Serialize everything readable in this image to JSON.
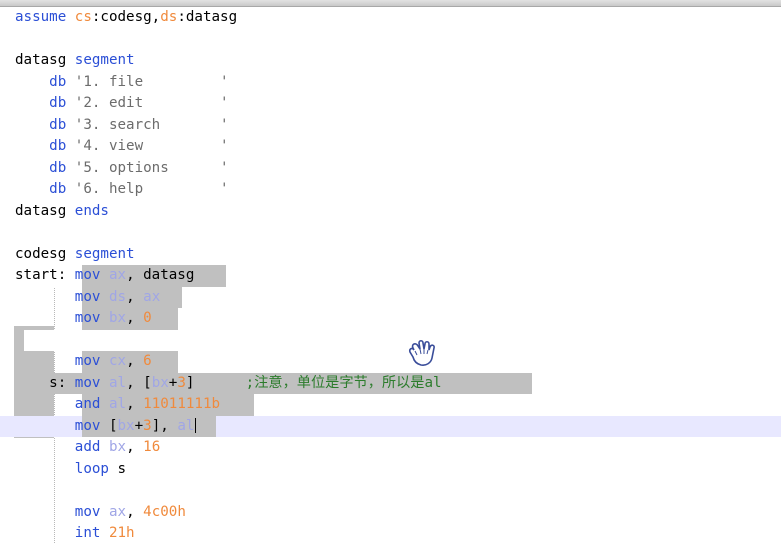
{
  "lines": [
    {
      "tokens": [
        [
          "kw",
          "assume "
        ],
        [
          "num",
          "cs"
        ],
        [
          "blk",
          ":codesg,"
        ],
        [
          "num",
          "ds"
        ],
        [
          "blk",
          ":datasg"
        ]
      ]
    },
    {
      "tokens": []
    },
    {
      "tokens": [
        [
          "blk",
          "datasg "
        ],
        [
          "kw",
          "segment"
        ]
      ]
    },
    {
      "tokens": [
        [
          "blk",
          "    "
        ],
        [
          "kw",
          "db "
        ],
        [
          "str",
          "'1. file         '"
        ]
      ]
    },
    {
      "tokens": [
        [
          "blk",
          "    "
        ],
        [
          "kw",
          "db "
        ],
        [
          "str",
          "'2. edit         '"
        ]
      ]
    },
    {
      "tokens": [
        [
          "blk",
          "    "
        ],
        [
          "kw",
          "db "
        ],
        [
          "str",
          "'3. search       '"
        ]
      ]
    },
    {
      "tokens": [
        [
          "blk",
          "    "
        ],
        [
          "kw",
          "db "
        ],
        [
          "str",
          "'4. view         '"
        ]
      ]
    },
    {
      "tokens": [
        [
          "blk",
          "    "
        ],
        [
          "kw",
          "db "
        ],
        [
          "str",
          "'5. options      '"
        ]
      ]
    },
    {
      "tokens": [
        [
          "blk",
          "    "
        ],
        [
          "kw",
          "db "
        ],
        [
          "str",
          "'6. help         '"
        ]
      ]
    },
    {
      "tokens": [
        [
          "blk",
          "datasg "
        ],
        [
          "kw",
          "ends"
        ]
      ]
    },
    {
      "tokens": []
    },
    {
      "tokens": [
        [
          "blk",
          "codesg "
        ],
        [
          "kw",
          "segment"
        ]
      ]
    },
    {
      "tokens": [
        [
          "blk",
          "start: "
        ],
        [
          "ins",
          "mov "
        ],
        [
          "reg",
          "ax"
        ],
        [
          "blk",
          ", datasg"
        ]
      ]
    },
    {
      "tokens": [
        [
          "blk",
          "       "
        ],
        [
          "ins",
          "mov "
        ],
        [
          "reg",
          "ds"
        ],
        [
          "blk",
          ", "
        ],
        [
          "reg",
          "ax"
        ]
      ]
    },
    {
      "tokens": [
        [
          "blk",
          "       "
        ],
        [
          "ins",
          "mov "
        ],
        [
          "reg",
          "bx"
        ],
        [
          "blk",
          ", "
        ],
        [
          "num",
          "0"
        ]
      ]
    },
    {
      "tokens": []
    },
    {
      "tokens": [
        [
          "blk",
          "       "
        ],
        [
          "ins",
          "mov "
        ],
        [
          "reg",
          "cx"
        ],
        [
          "blk",
          ", "
        ],
        [
          "num",
          "6"
        ]
      ]
    },
    {
      "tokens": [
        [
          "blk",
          "    s: "
        ],
        [
          "ins",
          "mov "
        ],
        [
          "reg",
          "al"
        ],
        [
          "blk",
          ", ["
        ],
        [
          "reg",
          "bx"
        ],
        [
          "blk",
          "+"
        ],
        [
          "num",
          "3"
        ],
        [
          "blk",
          "]      "
        ],
        [
          "cmt",
          ";注意，单位是字节，所以是al"
        ]
      ]
    },
    {
      "tokens": [
        [
          "blk",
          "       "
        ],
        [
          "ins",
          "and "
        ],
        [
          "reg",
          "al"
        ],
        [
          "blk",
          ", "
        ],
        [
          "num",
          "11011111b"
        ]
      ]
    },
    {
      "tokens": [
        [
          "blk",
          "       "
        ],
        [
          "ins",
          "mov "
        ],
        [
          "blk",
          "["
        ],
        [
          "reg",
          "bx"
        ],
        [
          "blk",
          "+"
        ],
        [
          "num",
          "3"
        ],
        [
          "blk",
          "], "
        ],
        [
          "reg",
          "al"
        ]
      ],
      "cursor": true
    },
    {
      "tokens": [
        [
          "blk",
          "       "
        ],
        [
          "ins",
          "add "
        ],
        [
          "reg",
          "bx"
        ],
        [
          "blk",
          ", "
        ],
        [
          "num",
          "16"
        ]
      ]
    },
    {
      "tokens": [
        [
          "blk",
          "       "
        ],
        [
          "ins",
          "loop "
        ],
        [
          "blk",
          "s"
        ]
      ]
    },
    {
      "tokens": []
    },
    {
      "tokens": [
        [
          "blk",
          "       "
        ],
        [
          "ins",
          "mov "
        ],
        [
          "reg",
          "ax"
        ],
        [
          "blk",
          ", "
        ],
        [
          "num",
          "4c00h"
        ]
      ]
    },
    {
      "tokens": [
        [
          "blk",
          "       "
        ],
        [
          "ins",
          "int "
        ],
        [
          "num",
          "21h"
        ]
      ]
    }
  ],
  "icons": {
    "pointer": "hand-pointer-icon"
  }
}
